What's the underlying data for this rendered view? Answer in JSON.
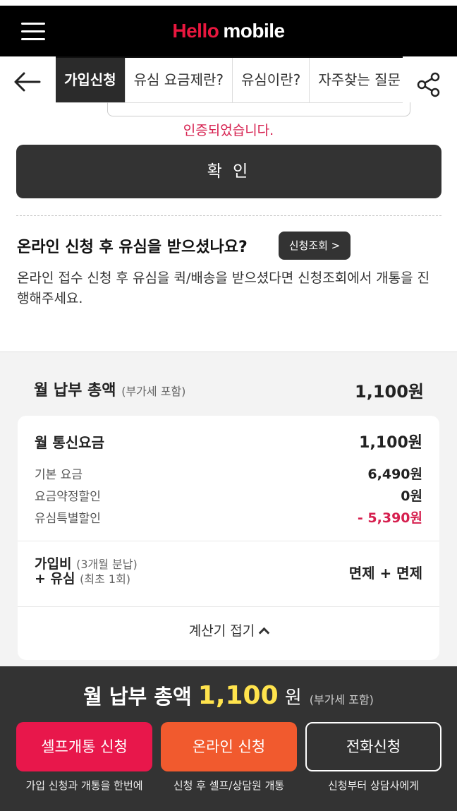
{
  "header": {
    "logo_hello": "Hello",
    "logo_mobile": "mobile"
  },
  "nav": {
    "tabs": [
      {
        "label": "가입신청",
        "active": true
      },
      {
        "label": "유심 요금제란?",
        "active": false
      },
      {
        "label": "유심이란?",
        "active": false
      },
      {
        "label": "자주찾는 질문",
        "active": false
      }
    ]
  },
  "auth": {
    "verified_text": "인증되었습니다.",
    "confirm_label": "확 인"
  },
  "sim_notice": {
    "title": "온라인 신청 후 유심을 받으셨나요?",
    "inquiry_button": "신청조회 >",
    "description": "온라인 접수 신청 후 유심을 퀵/배송을 받으셨다면 신청조회에서 개통을 진행해주세요."
  },
  "calculator": {
    "total_label": "월 납부 총액",
    "total_vat_note": "(부가세 포함)",
    "total_value": "1,100원",
    "fee_title": "월 통신요금",
    "fee_value": "1,100원",
    "items": [
      {
        "label": "기본 요금",
        "value": "6,490원"
      },
      {
        "label": "요금약정할인",
        "value": "0원"
      },
      {
        "label": "유심특별할인",
        "value": "- 5,390원"
      }
    ],
    "join_fee_label": "가입비",
    "join_fee_note": "(3개월 분납)",
    "sim_fee_label": "+ 유심",
    "sim_fee_note": "(최초 1회)",
    "join_value": "면제 + 면제",
    "collapse_label": "계산기 접기"
  },
  "bottom": {
    "total_label": "월 납부 총액",
    "total_amount": "1,100",
    "total_unit": "원",
    "total_vat_note": "(부가세 포함)",
    "buttons": [
      {
        "label": "셀프개통 신청",
        "sub": "가입 신청과 개통을 한번에"
      },
      {
        "label": "온라인 신청",
        "sub": "신청 후 셀프/상담원 개통"
      },
      {
        "label": "전화신청",
        "sub": "신청부터 상담사에게"
      }
    ]
  },
  "colors": {
    "brand_red": "#e8173e",
    "orange": "#f15a2e",
    "highlight_yellow": "#ffe34d",
    "discount_red": "#d6204f",
    "dark": "#333333"
  }
}
